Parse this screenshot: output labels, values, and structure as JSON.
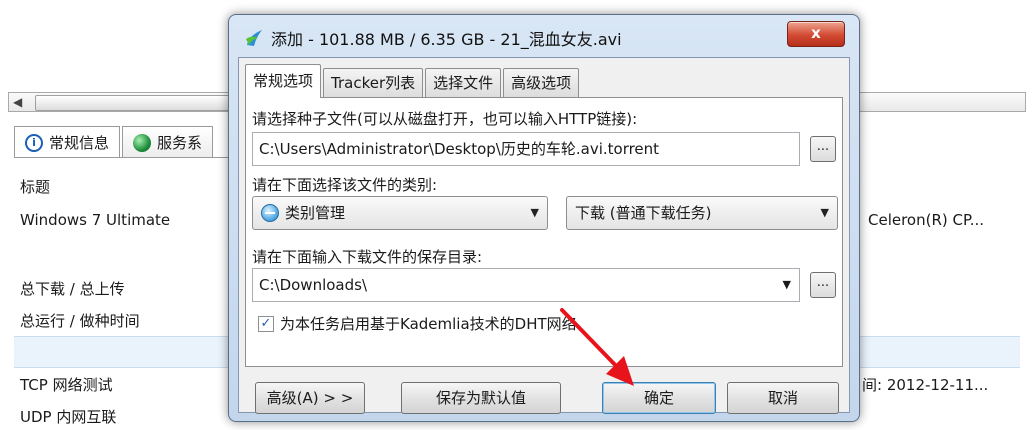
{
  "background": {
    "tabs": [
      {
        "label": "常规信息",
        "icon": "info-icon"
      },
      {
        "label": "服务系",
        "icon": "globe-icon"
      }
    ],
    "left_column": {
      "header": "标题",
      "os": "Windows 7 Ultimate",
      "download_upload": "总下载 / 总上传",
      "runtime": "总运行 / 做种时间",
      "tcp_test": "TCP 网络测试",
      "udp_test": "UDP 内网互联"
    },
    "right_column": {
      "cpu": "Celeron(R) CP...",
      "time": "间: 2012-12-11..."
    }
  },
  "dialog": {
    "title": "添加 - 101.88 MB / 6.35 GB - 21_混血女友.avi",
    "close_label": "x",
    "tabs": [
      "常规选项",
      "Tracker列表",
      "选择文件",
      "高级选项"
    ],
    "active_tab": 0,
    "torrent_label": "请选择种子文件(可以从磁盘打开，也可以输入HTTP链接):",
    "torrent_path": "C:\\Users\\Administrator\\Desktop\\历史的车轮.avi.torrent",
    "browse_label": "...",
    "category_label": "请在下面选择该文件的类别:",
    "category_value": "类别管理",
    "download_type_value": "下载 (普通下载任务)",
    "save_dir_label": "请在下面输入下载文件的保存目录:",
    "save_dir_value": "C:\\Downloads\\",
    "dht_checked": true,
    "dht_label": "为本任务启用基于Kademlia技术的DHT网络.",
    "buttons": {
      "advanced": "高级(A) > >",
      "save_default": "保存为默认值",
      "ok": "确定",
      "cancel": "取消"
    }
  },
  "colors": {
    "title_bar": "#c9dbef",
    "close_button": "#d24a32",
    "annotation_arrow": "#e8141b"
  }
}
